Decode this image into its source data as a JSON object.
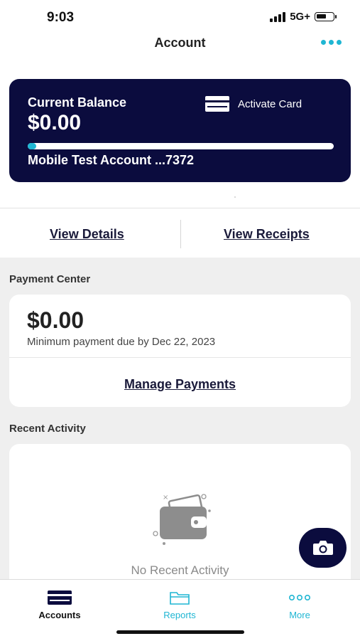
{
  "status_bar": {
    "time": "9:03",
    "network": "5G+",
    "battery_level": 0.6
  },
  "header": {
    "title": "Account",
    "more_icon": "more-horizontal-icon"
  },
  "balance_card": {
    "label": "Current Balance",
    "amount": "$0.00",
    "activate_label": "Activate Card",
    "account_name": "Mobile Test Account ...7372",
    "progress_fraction": 0.01
  },
  "links": {
    "details": "View Details",
    "receipts": "View Receipts"
  },
  "payment_center": {
    "section_label": "Payment Center",
    "amount": "$0.00",
    "due_text": "Minimum payment due by Dec 22, 2023",
    "manage_label": "Manage Payments"
  },
  "recent_activity": {
    "section_label": "Recent Activity",
    "empty_text": "No Recent Activity"
  },
  "tabs": [
    {
      "label": "Accounts",
      "icon": "card-icon",
      "active": true
    },
    {
      "label": "Reports",
      "icon": "folder-icon",
      "active": false
    },
    {
      "label": "More",
      "icon": "more-horizontal-icon",
      "active": false
    }
  ],
  "colors": {
    "navy": "#0b0c3e",
    "accent": "#1fb6d3"
  }
}
